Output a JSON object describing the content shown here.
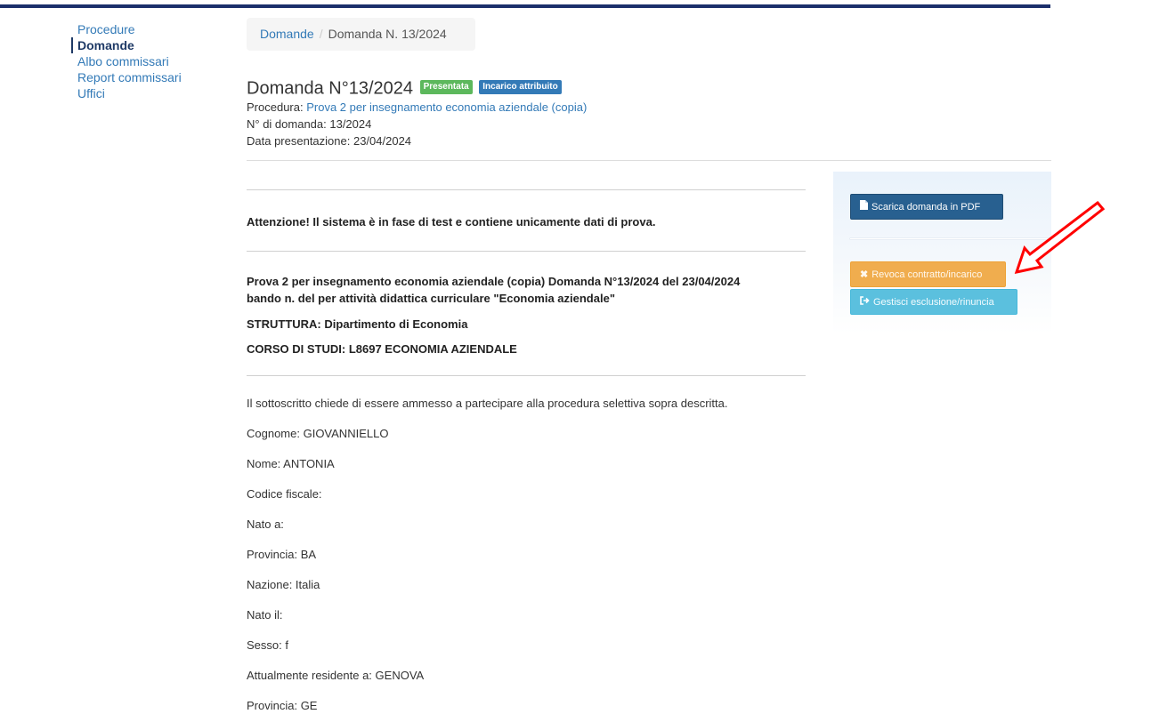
{
  "sidebar": {
    "items": [
      {
        "label": "Procedure"
      },
      {
        "label": "Domande"
      },
      {
        "label": "Albo commissari"
      },
      {
        "label": "Report commissari"
      },
      {
        "label": "Uffici"
      }
    ]
  },
  "breadcrumb": {
    "root": "Domande",
    "separator": "/",
    "current": "Domanda N. 13/2024"
  },
  "header": {
    "title": "Domanda N°13/2024",
    "badge_status": "Presentata",
    "badge_assign": "Incarico attribuito",
    "procedura_label": "Procedura:",
    "procedura_link": "Prova 2 per insegnamento economia aziendale (copia)",
    "numero": "N° di domanda: 13/2024",
    "data": "Data presentazione: 23/04/2024"
  },
  "content": {
    "warning": "Attenzione! Il sistema è in fase di test e contiene unicamente dati di prova.",
    "prova_line1": "Prova 2 per insegnamento economia aziendale (copia) Domanda N°13/2024 del 23/04/2024",
    "prova_line2": "bando n. del per attività didattica curriculare \"Economia aziendale\"",
    "struttura": "STRUTTURA: Dipartimento di Economia",
    "corso": "CORSO DI STUDI: L8697 ECONOMIA AZIENDALE",
    "intro": "Il sottoscritto chiede di essere ammesso a partecipare alla procedura selettiva sopra descritta.",
    "fields": [
      "Cognome: GIOVANNIELLO",
      "Nome: ANTONIA",
      "Codice fiscale: ",
      "Nato a:",
      "Provincia: BA",
      "Nazione: Italia",
      "Nato il:",
      "Sesso: f",
      "Attualmente residente a: GENOVA",
      "Provincia: GE"
    ]
  },
  "panel": {
    "pdf_button": "Scarica domanda in PDF",
    "revoca_button": "Revoca contratto/incarico",
    "gestisci_button": "Gestisci esclusione/rinuncia"
  },
  "colors": {
    "topbar": "#1b2f6b",
    "link": "#337ab7",
    "badge_green": "#5cb85c",
    "badge_blue": "#337ab7",
    "btn_pdf": "#286090",
    "btn_revoca": "#f0ad4e",
    "btn_gestisci": "#5bc0de",
    "annotation_arrow": "#ff0000"
  },
  "icons": {
    "pdf": "file-icon",
    "revoca": "close-icon",
    "gestisci": "sign-out-icon",
    "annotation": "red-arrow-icon"
  }
}
